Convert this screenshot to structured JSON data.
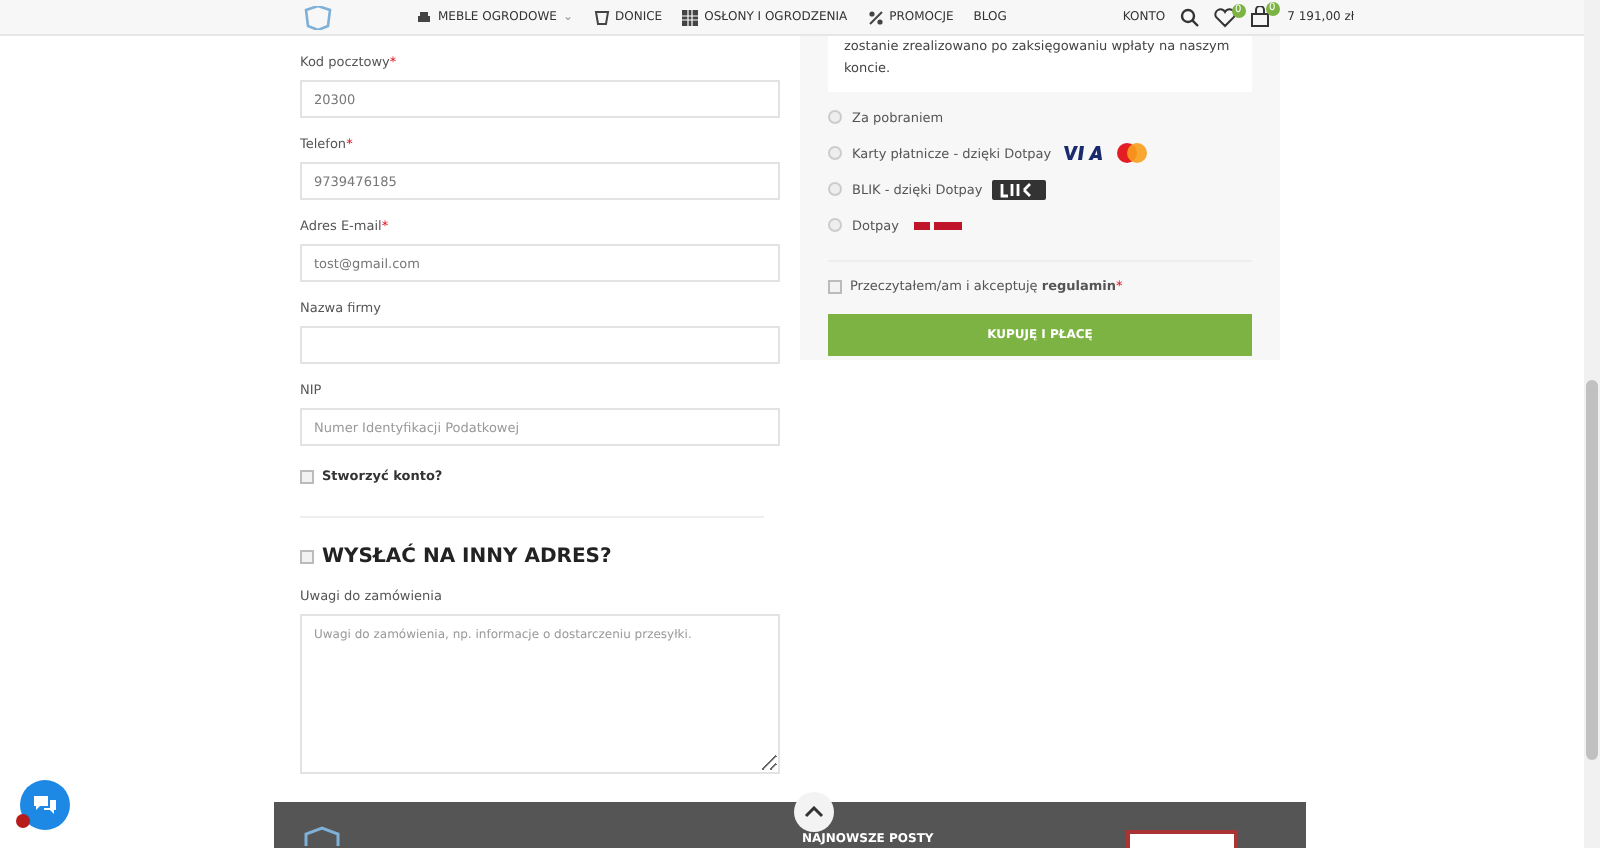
{
  "nav": {
    "items": [
      {
        "label": "MEBLE OGRODOWE",
        "kind": "sofa",
        "caret": "⌄"
      },
      {
        "label": "DONICE",
        "kind": "pot"
      },
      {
        "label": "OSŁONY I OGRODZENIA",
        "kind": "fence"
      },
      {
        "label": "PROMOCJE",
        "kind": "percent"
      },
      {
        "label": "BLOG",
        "kind": "text"
      }
    ],
    "account": "KONTO",
    "wishlist_count": "0",
    "cart_count": "0",
    "cart_total": "7 191,00 zł"
  },
  "billing": {
    "fields": [
      {
        "label": "Kod pocztowy",
        "required_mark": "*",
        "value": "20300"
      },
      {
        "label": "Telefon",
        "required_mark": "*",
        "value": "9739476185"
      },
      {
        "label": "Adres E-mail",
        "required_mark": "*",
        "value": "tost@gmail.com"
      },
      {
        "label": "Nazwa firmy"
      },
      {
        "label": "NIP",
        "placeholder": "Numer Identyfikacji Podatkowej"
      }
    ],
    "create_account": {
      "label": "Stworzyć konto?",
      "checked": false
    }
  },
  "shipping": {
    "label": "WYSŁAĆ NA INNY ADRES?",
    "checked": false
  },
  "notes": {
    "label": "Uwagi do zamówienia",
    "placeholder": "Uwagi do zamówienia, np. informacje o dostarczeniu przesyłki."
  },
  "payment": {
    "description": "zostanie zrealizowano po zaksięgowaniu wpłaty na naszym koncie.",
    "methods": [
      {
        "label": "Za pobraniem",
        "kind": "plain",
        "selected": false
      },
      {
        "label": "Karty płatnicze - dzięki Dotpay",
        "kind": "cards",
        "selected": false
      },
      {
        "label": "BLIK - dzięki Dotpay",
        "kind": "blik",
        "selected": false
      },
      {
        "label": "Dotpay",
        "kind": "dotpay",
        "selected": false
      }
    ],
    "terms": {
      "text": "Przeczytałem/am i akceptuję **regulamin**",
      "required_mark": "*",
      "checked": false
    },
    "button": "KUPUJĘ I PŁACĘ"
  },
  "footer": {
    "heading": "NAJNOWSZE POSTY"
  }
}
